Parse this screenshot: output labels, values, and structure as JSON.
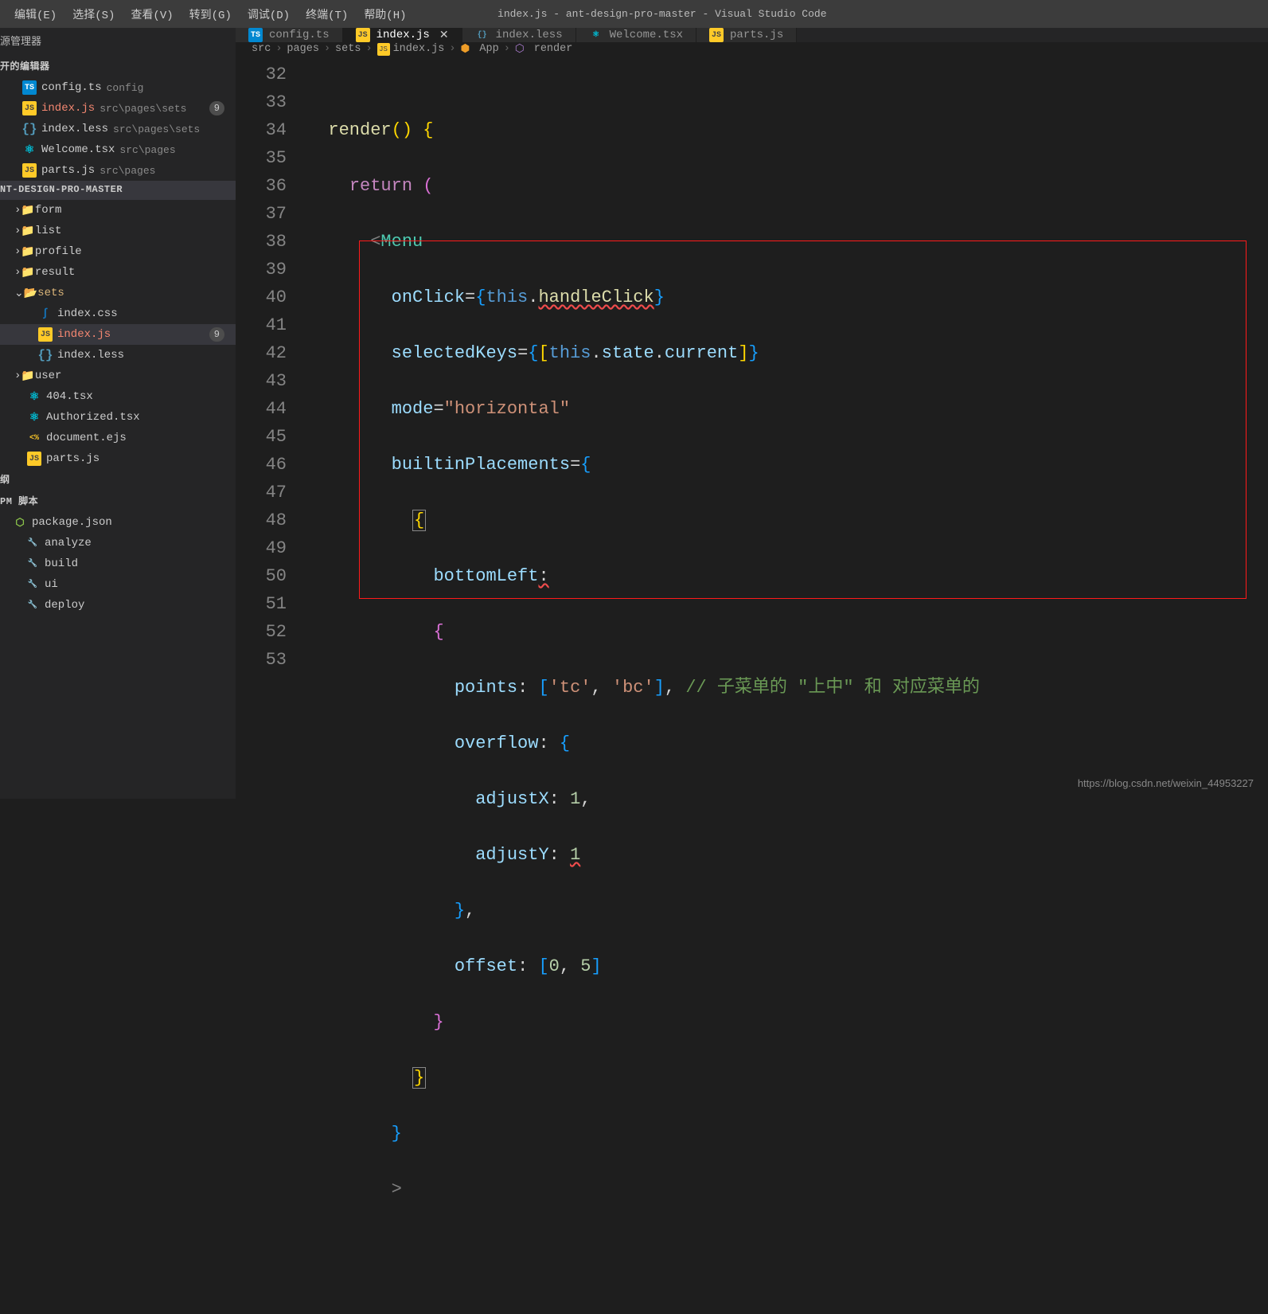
{
  "menubar": {
    "items": [
      "编辑(E)",
      "选择(S)",
      "查看(V)",
      "转到(G)",
      "调试(D)",
      "终端(T)",
      "帮助(H)"
    ],
    "title": "index.js - ant-design-pro-master - Visual Studio Code"
  },
  "sidebar": {
    "header": "源管理器",
    "openEditorsTitle": "开的编辑器",
    "openEditors": [
      {
        "icon": "ts",
        "name": "config.ts",
        "path": "config",
        "err": false,
        "badge": null
      },
      {
        "icon": "js",
        "name": "index.js",
        "path": "src\\pages\\sets",
        "err": true,
        "badge": "9"
      },
      {
        "icon": "less",
        "name": "index.less",
        "path": "src\\pages\\sets",
        "err": false,
        "badge": null
      },
      {
        "icon": "react",
        "name": "Welcome.tsx",
        "path": "src\\pages",
        "err": false,
        "badge": null
      },
      {
        "icon": "js",
        "name": "parts.js",
        "path": "src\\pages",
        "err": false,
        "badge": null
      }
    ],
    "projectTitle": "NT-DESIGN-PRO-MASTER",
    "folders": [
      {
        "chev": "›",
        "icon": "folder",
        "name": "form"
      },
      {
        "chev": "›",
        "icon": "folder",
        "name": "list"
      },
      {
        "chev": "›",
        "icon": "folder",
        "name": "profile"
      },
      {
        "chev": "›",
        "icon": "folder",
        "name": "result"
      }
    ],
    "setsFolder": {
      "chev": "⌄",
      "icon": "folder-open",
      "name": "sets",
      "modified": true
    },
    "setsFiles": [
      {
        "icon": "css3",
        "name": "index.css",
        "err": false,
        "badge": null
      },
      {
        "icon": "js",
        "name": "index.js",
        "err": true,
        "badge": "9",
        "active": true
      },
      {
        "icon": "less",
        "name": "index.less",
        "err": false,
        "badge": null
      }
    ],
    "userFolder": {
      "chev": "›",
      "icon": "folder",
      "name": "user"
    },
    "rootFiles": [
      {
        "icon": "react",
        "name": "404.tsx"
      },
      {
        "icon": "react",
        "name": "Authorized.tsx"
      },
      {
        "icon": "ejs",
        "name": "document.ejs"
      },
      {
        "icon": "js",
        "name": "parts.js"
      }
    ],
    "outlineTitle": "纲",
    "npmTitle": "PM 脚本",
    "packageJson": "package.json",
    "scripts": [
      "analyze",
      "build",
      "ui",
      "deploy"
    ]
  },
  "tabs": [
    {
      "icon": "ts",
      "label": "config.ts",
      "active": false
    },
    {
      "icon": "js",
      "label": "index.js",
      "active": true,
      "close": true
    },
    {
      "icon": "less",
      "label": "index.less",
      "active": false
    },
    {
      "icon": "react",
      "label": "Welcome.tsx",
      "active": false
    },
    {
      "icon": "js",
      "label": "parts.js",
      "active": false
    }
  ],
  "breadcrumb": [
    "src",
    "pages",
    "sets",
    "index.js",
    "App",
    "render"
  ],
  "code": {
    "startLine": 32,
    "lines": [
      "",
      "render() {",
      "  return (",
      "    <Menu",
      "      onClick={this.handleClick}",
      "      selectedKeys={[this.state.current]}",
      "      mode=\"horizontal\"",
      "      builtinPlacements={",
      "        {",
      "          bottomLeft:",
      "          {",
      "            points: ['tc', 'bc'], // 子菜单的 \"上中\" 和 对应菜单的",
      "            overflow: {",
      "              adjustX: 1,",
      "              adjustY: 1",
      "            },",
      "            offset: [0, 5]",
      "          }",
      "        }",
      "      }",
      "      >",
      ""
    ]
  },
  "watermark": "https://blog.csdn.net/weixin_44953227"
}
